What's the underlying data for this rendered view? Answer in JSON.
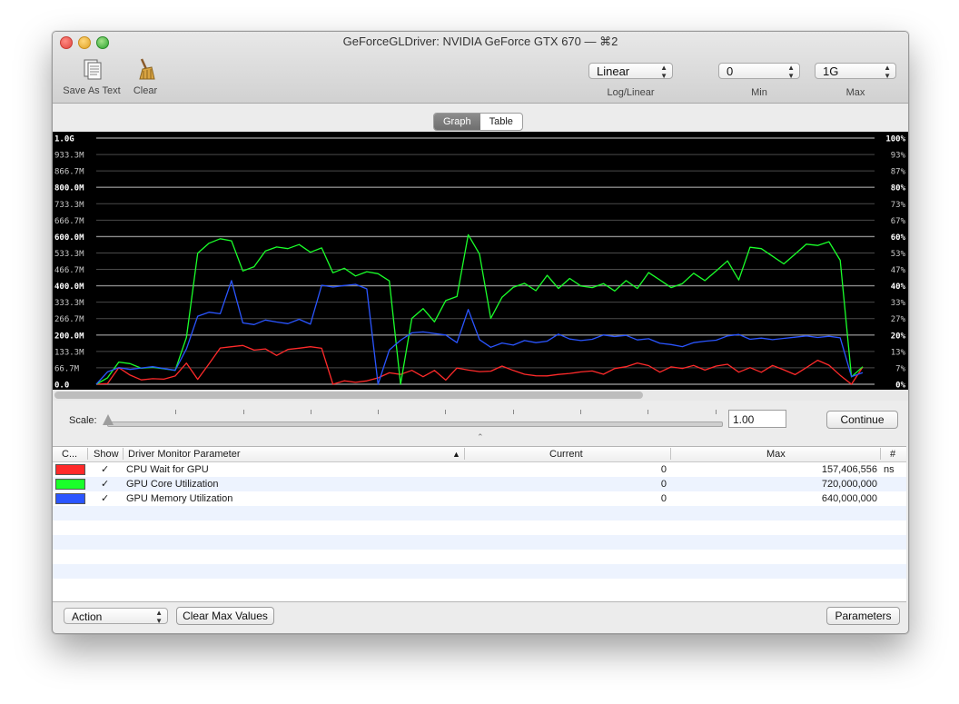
{
  "window": {
    "title": "GeForceGLDriver: NVIDIA GeForce GTX 670 — ⌘2",
    "traffic_lights": [
      "close",
      "minimize",
      "zoom"
    ]
  },
  "toolbar": {
    "save_as_text_label": "Save As Text",
    "clear_label": "Clear",
    "scale_mode": {
      "value": "Linear",
      "label": "Log/Linear"
    },
    "min": {
      "value": "0",
      "label": "Min"
    },
    "max": {
      "value": "1G",
      "label": "Max"
    }
  },
  "view_tabs": {
    "graph": "Graph",
    "table": "Table",
    "selected": "Graph"
  },
  "chart_data": {
    "type": "line",
    "y_left_ticks": [
      "1.0G",
      "933.3M",
      "866.7M",
      "800.0M",
      "733.3M",
      "666.7M",
      "600.0M",
      "533.3M",
      "466.7M",
      "400.0M",
      "333.3M",
      "266.7M",
      "200.0M",
      "133.3M",
      "66.7M",
      "0.0"
    ],
    "y_right_ticks": [
      "100%",
      "93%",
      "87%",
      "80%",
      "73%",
      "67%",
      "60%",
      "53%",
      "47%",
      "40%",
      "33%",
      "27%",
      "20%",
      "13%",
      "7%",
      "0%"
    ],
    "ylim": [
      0,
      1000000000
    ],
    "series": [
      {
        "name": "CPU Wait for GPU",
        "color": "#ff2a2a",
        "values": [
          0,
          10,
          60,
          30,
          25,
          30,
          28,
          30,
          75,
          20,
          90,
          140,
          145,
          150,
          135,
          140,
          128,
          145,
          150,
          145,
          135,
          0,
          25,
          15,
          10,
          22,
          50,
          40,
          60,
          38,
          45,
          28,
          55,
          65,
          55,
          42,
          70,
          45,
          48,
          38,
          45,
          40,
          55,
          50,
          65,
          48,
          75,
          60,
          90,
          72,
          60,
          78,
          68,
          80,
          65,
          85,
          70,
          60,
          60,
          45,
          80,
          55,
          50,
          75,
          90,
          85,
          40,
          0,
          70
        ]
      },
      {
        "name": "GPU Core Utilization",
        "color": "#1aff2a",
        "values": [
          0,
          30,
          90,
          80,
          65,
          80,
          70,
          60,
          190,
          540,
          580,
          580,
          590,
          460,
          470,
          530,
          550,
          540,
          560,
          540,
          550,
          460,
          460,
          440,
          450,
          460,
          420,
          0,
          260,
          300,
          250,
          340,
          360,
          600,
          540,
          260,
          350,
          390,
          410,
          380,
          450,
          400,
          430,
          410,
          400,
          420,
          390,
          410,
          400,
          450,
          420,
          400,
          420,
          440,
          410,
          460,
          490,
          420,
          560,
          540,
          520,
          500,
          540,
          580,
          560,
          590,
          500,
          30,
          60
        ]
      },
      {
        "name": "GPU Memory Utilization",
        "color": "#2a55ff",
        "values": [
          0,
          50,
          60,
          60,
          55,
          60,
          60,
          60,
          140,
          280,
          300,
          290,
          410,
          260,
          250,
          250,
          260,
          250,
          260,
          255,
          395,
          395,
          390,
          395,
          380,
          0,
          150,
          190,
          205,
          220,
          210,
          200,
          180,
          300,
          170,
          150,
          160,
          170,
          170,
          180,
          175,
          200,
          195,
          185,
          190,
          200,
          190,
          195,
          180,
          185,
          170,
          150,
          160,
          180,
          175,
          190,
          200,
          195,
          190,
          195,
          185,
          190,
          195,
          200,
          190,
          195,
          185,
          20,
          40
        ]
      }
    ]
  },
  "scale_control": {
    "label": "Scale:",
    "value": "1.00",
    "continue_label": "Continue"
  },
  "table": {
    "headers": {
      "color": "C...",
      "show": "Show",
      "parameter": "Driver Monitor Parameter",
      "current": "Current",
      "max": "Max",
      "unit": "#"
    },
    "rows": [
      {
        "color": "#ff2a2a",
        "show": "✓",
        "parameter": "CPU Wait for GPU",
        "current": "0",
        "max": "157,406,556",
        "unit": "ns"
      },
      {
        "color": "#1aff2a",
        "show": "✓",
        "parameter": "GPU Core Utilization",
        "current": "0",
        "max": "720,000,000",
        "unit": ""
      },
      {
        "color": "#2a55ff",
        "show": "✓",
        "parameter": "GPU Memory Utilization",
        "current": "0",
        "max": "640,000,000",
        "unit": ""
      }
    ]
  },
  "bottom": {
    "action_label": "Action",
    "clear_max_label": "Clear Max Values",
    "parameters_label": "Parameters"
  }
}
